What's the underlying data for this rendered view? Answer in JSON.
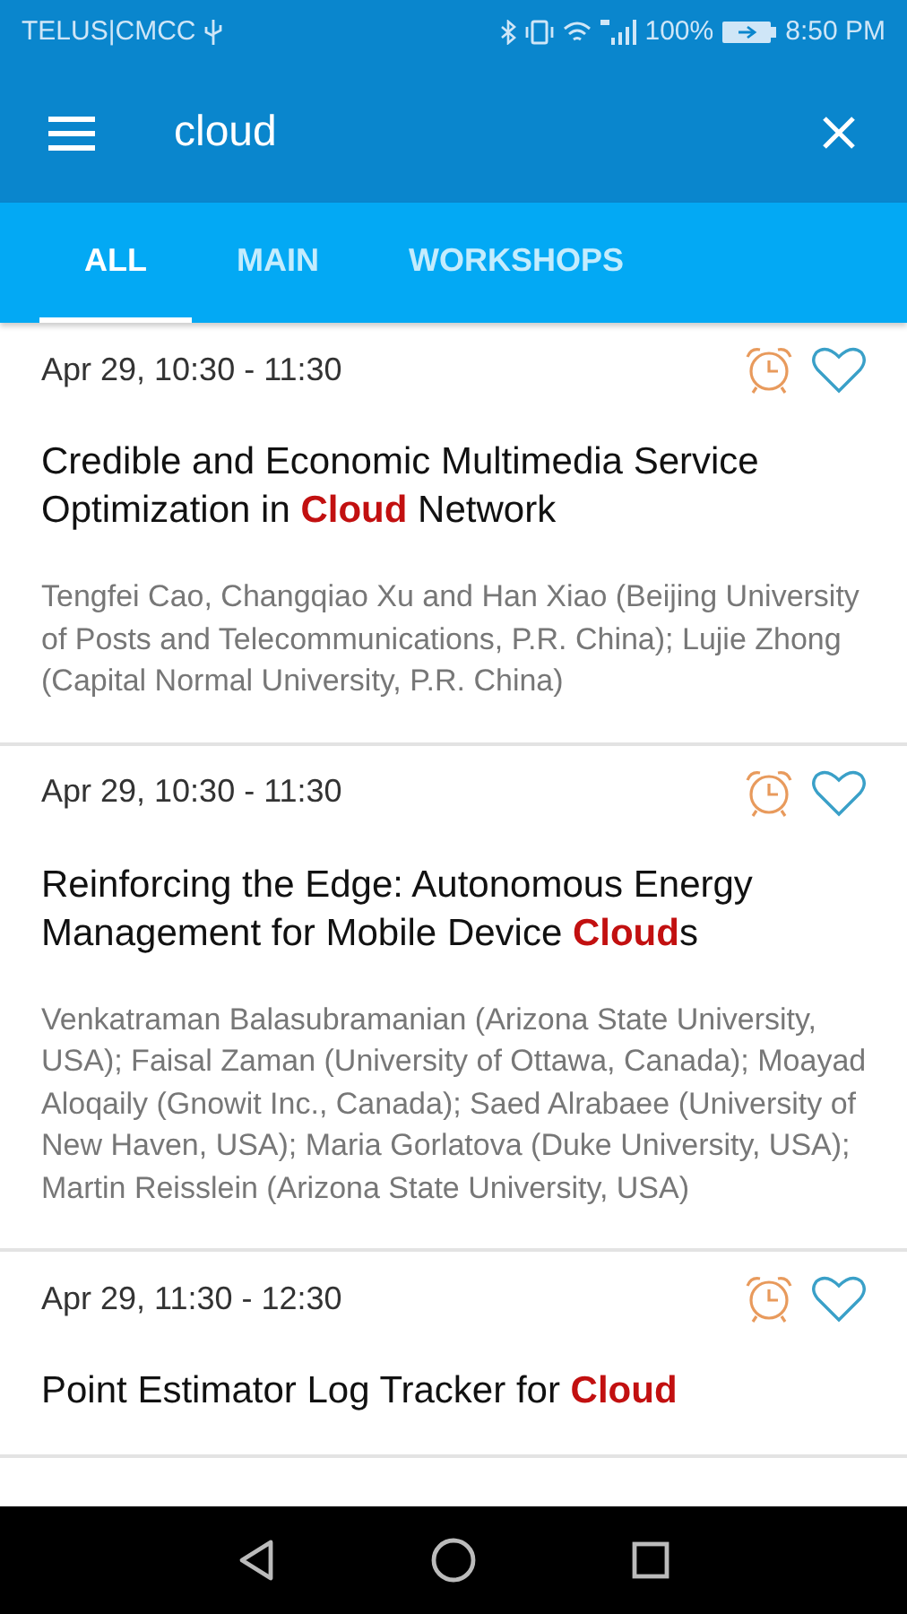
{
  "status_bar": {
    "carrier": "TELUS|CMCC",
    "battery": "100%",
    "time": "8:50 PM"
  },
  "search": {
    "value": "cloud"
  },
  "tabs": [
    {
      "label": "ALL",
      "selected": true
    },
    {
      "label": "MAIN",
      "selected": false
    },
    {
      "label": "WORKSHOPS",
      "selected": false
    }
  ],
  "sessions": [
    {
      "time": "Apr 29, 10:30 - 11:30",
      "title": "Credible and Economic Multimedia Service Optimization in **Cloud** Network",
      "authors": "Tengfei Cao, Changqiao Xu and Han Xiao (Beijing University of Posts and Telecommunications, P.R. China); Lujie Zhong (Capital Normal University, P.R. China)",
      "favorite": false
    },
    {
      "time": "Apr 29, 10:30 - 11:30",
      "title": "Reinforcing the Edge: Autonomous Energy Management for Mobile Device **Cloud**s",
      "authors": "Venkatraman Balasubramanian (Arizona State University, USA); Faisal Zaman (University of Ottawa, Canada); Moayad Aloqaily (Gnowit Inc., Canada); Saed Alrabaee (University of New Haven, USA); Maria Gorlatova (Duke University, USA); Martin Reisslein (Arizona State University, USA)",
      "favorite": false
    },
    {
      "time": "Apr 29, 11:30 - 12:30",
      "title": "Point Estimator Log Tracker for **Cloud**",
      "favorite": false
    }
  ]
}
